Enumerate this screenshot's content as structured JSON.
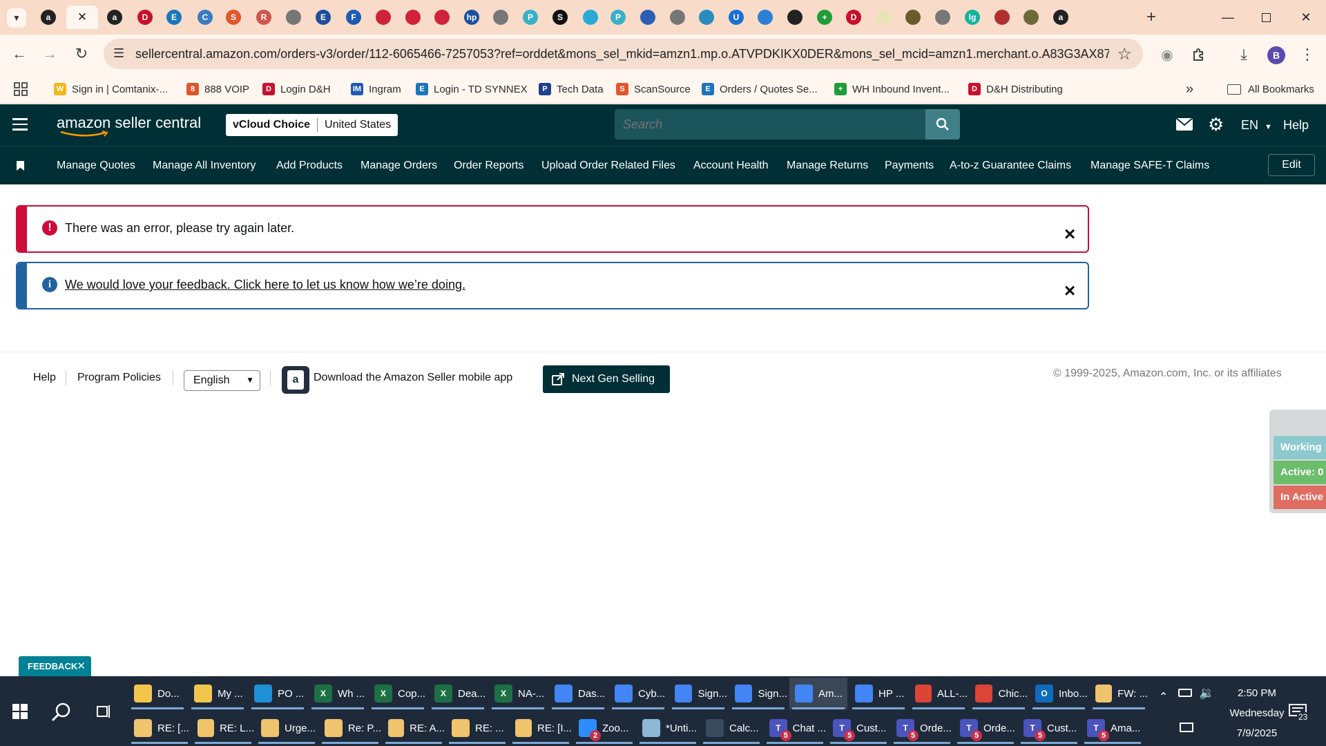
{
  "browser": {
    "tab_favicons": [
      {
        "name": "amazon-a-icon",
        "glyph": "a",
        "color": "#222222"
      },
      {
        "name": "amazon-a-icon",
        "glyph": "a",
        "color": "#222222"
      },
      {
        "name": "amazon-a-icon",
        "glyph": "a",
        "color": "#222222"
      },
      {
        "name": "dh-icon",
        "glyph": "D",
        "color": "#c8102e"
      },
      {
        "name": "ec-icon",
        "glyph": "E",
        "color": "#1b75bb"
      },
      {
        "name": "circle-icon",
        "glyph": "C",
        "color": "#3b7bbf"
      },
      {
        "name": "scansource-icon",
        "glyph": "S",
        "color": "#e2562b"
      },
      {
        "name": "circle-icon",
        "glyph": "R",
        "color": "#d0554a"
      },
      {
        "name": "globe-icon",
        "glyph": "",
        "color": "#777777"
      },
      {
        "name": "etn-icon",
        "glyph": "E",
        "color": "#1f4e9a"
      },
      {
        "name": "ingram-icon",
        "glyph": "F",
        "color": "#1e5bb5"
      },
      {
        "name": "record-icon",
        "glyph": "",
        "color": "#d0223a"
      },
      {
        "name": "record-icon",
        "glyph": "",
        "color": "#d0223a"
      },
      {
        "name": "record-icon",
        "glyph": "",
        "color": "#d0223a"
      },
      {
        "name": "hp-icon",
        "glyph": "hp",
        "color": "#1d4fa0"
      },
      {
        "name": "globe-icon",
        "glyph": "",
        "color": "#777777"
      },
      {
        "name": "link-icon",
        "glyph": "P",
        "color": "#37b0c9"
      },
      {
        "name": "s-icon",
        "glyph": "S",
        "color": "#111111"
      },
      {
        "name": "circle-icon",
        "glyph": "",
        "color": "#2aa9d6"
      },
      {
        "name": "link-icon",
        "glyph": "P",
        "color": "#37b0c9"
      },
      {
        "name": "arrow-icon",
        "glyph": "",
        "color": "#2c5fb4"
      },
      {
        "name": "globe-icon",
        "glyph": "",
        "color": "#777777"
      },
      {
        "name": "clock-icon",
        "glyph": "",
        "color": "#2a8bbf"
      },
      {
        "name": "u-icon",
        "glyph": "U",
        "color": "#1a6fd4"
      },
      {
        "name": "cloud-icon",
        "glyph": "",
        "color": "#2d7fd3"
      },
      {
        "name": "openai-icon",
        "glyph": "",
        "color": "#222222"
      },
      {
        "name": "plus-icon",
        "glyph": "+",
        "color": "#1f9d3a"
      },
      {
        "name": "dh-icon",
        "glyph": "D",
        "color": "#c8102e"
      },
      {
        "name": "chart-icon",
        "glyph": "",
        "color": "#e9e2b8"
      },
      {
        "name": "bridge-icon",
        "glyph": "",
        "color": "#6b5a2e"
      },
      {
        "name": "circle-icon",
        "glyph": "",
        "color": "#777777"
      },
      {
        "name": "logi-icon",
        "glyph": "lg",
        "color": "#14b29a"
      },
      {
        "name": "mask-icon",
        "glyph": "",
        "color": "#b03030"
      },
      {
        "name": "circle-icon",
        "glyph": "",
        "color": "#6b6b3a"
      },
      {
        "name": "amazon-a-icon",
        "glyph": "a",
        "color": "#222222"
      }
    ],
    "active_tab_index": 1,
    "url": "sellercentral.amazon.com/orders-v3/order/112-6065466-7257053?ref=orddet&mons_sel_mkid=amzn1.mp.o.ATVPDKIKX0DER&mons_sel_mcid=amzn1.merchant.o.A83G3AX87QKJF...",
    "profile_initial": "B",
    "bookmarks": [
      {
        "label": "Sign in | Comtanix-...",
        "icon": "comtanix-icon",
        "color": "#f3b71b",
        "glyph": "W"
      },
      {
        "label": "888 VOIP",
        "icon": "voip-icon",
        "color": "#e0552b",
        "glyph": "8"
      },
      {
        "label": "Login D&H",
        "icon": "dh-icon",
        "color": "#c8102e",
        "glyph": "D"
      },
      {
        "label": "Ingram",
        "icon": "ingram-icon",
        "color": "#1e5bb5",
        "glyph": "IM"
      },
      {
        "label": "Login - TD SYNNEX",
        "icon": "ec-icon",
        "color": "#1b75bb",
        "glyph": "E"
      },
      {
        "label": "Tech Data",
        "icon": "techdata-icon",
        "color": "#1f3f8f",
        "glyph": "P"
      },
      {
        "label": "ScanSource",
        "icon": "scansource-icon",
        "color": "#e2562b",
        "glyph": "S"
      },
      {
        "label": "Orders / Quotes Se...",
        "icon": "ec-icon",
        "color": "#1b75bb",
        "glyph": "E"
      },
      {
        "label": "WH Inbound Invent...",
        "icon": "plus-icon",
        "color": "#1f9d3a",
        "glyph": "+"
      },
      {
        "label": "D&H Distributing",
        "icon": "dh-icon",
        "color": "#c8102e",
        "glyph": "D"
      }
    ],
    "more_bookmarks": "»",
    "all_bookmarks": "All Bookmarks"
  },
  "seller_central": {
    "logo_text": "amazon seller central",
    "store_name": "vCloud Choice",
    "marketplace": "United States",
    "search_placeholder": "Search",
    "language": "EN",
    "help_label": "Help",
    "nav_items": [
      "Manage Quotes",
      "Manage All Inventory",
      "Add Products",
      "Manage Orders",
      "Order Reports",
      "Upload Order Related Files",
      "Account Health",
      "Manage Returns",
      "Payments",
      "A-to-z Guarantee Claims",
      "Manage SAFE-T Claims"
    ],
    "edit_label": "Edit",
    "alerts": {
      "error_text": "There was an error, please try again later.",
      "error_color": "#cc0c39",
      "info_link": "We would love your feedback. Click here to let us know how we’re doing.",
      "info_color": "#2162a1"
    },
    "footer": {
      "help": "Help",
      "program_policies": "Program Policies",
      "language_selected": "English",
      "app_download": "Download the Amazon Seller mobile app",
      "next_gen": "Next Gen Selling",
      "copyright": "© 1999-2025, Amazon.com, Inc. or its affiliates"
    },
    "side_panel": [
      {
        "label": "Working",
        "color": "#8cc9ce"
      },
      {
        "label": "Active: 0",
        "color": "#6cbd6c"
      },
      {
        "label": "In Active",
        "color": "#e06c62"
      }
    ],
    "feedback_label": "FEEDBACK"
  },
  "taskbar": {
    "row1": [
      {
        "label": "Do...",
        "icon": "folder-icon",
        "color": "#f2c64d",
        "glyph": ""
      },
      {
        "label": "My ...",
        "icon": "folder-icon",
        "color": "#f2c64d",
        "glyph": ""
      },
      {
        "label": "PO ...",
        "icon": "edge-icon",
        "color": "#1f8fd6",
        "glyph": ""
      },
      {
        "label": "Wh ...",
        "icon": "excel-icon",
        "color": "#1d7044",
        "glyph": "X"
      },
      {
        "label": "Cop...",
        "icon": "excel-icon",
        "color": "#1d7044",
        "glyph": "X"
      },
      {
        "label": "Dea...",
        "icon": "excel-icon",
        "color": "#1d7044",
        "glyph": "X"
      },
      {
        "label": "NA-...",
        "icon": "excel-icon",
        "color": "#1d7044",
        "glyph": "X"
      },
      {
        "label": "Das...",
        "icon": "chrome-icon",
        "color": "#4285f4",
        "glyph": ""
      },
      {
        "label": "Cyb...",
        "icon": "chrome-icon",
        "color": "#4285f4",
        "glyph": ""
      },
      {
        "label": "Sign...",
        "icon": "chrome-icon",
        "color": "#4285f4",
        "glyph": ""
      },
      {
        "label": "Sign...",
        "icon": "chrome-icon",
        "color": "#4285f4",
        "glyph": ""
      },
      {
        "label": "Am...",
        "icon": "chrome-icon",
        "color": "#4285f4",
        "glyph": ""
      },
      {
        "label": "HP ...",
        "icon": "chrome-icon",
        "color": "#4285f4",
        "glyph": ""
      },
      {
        "label": "ALL-...",
        "icon": "chrome-icon",
        "color": "#db4437",
        "glyph": ""
      },
      {
        "label": "Chic...",
        "icon": "chrome-icon",
        "color": "#db4437",
        "glyph": ""
      },
      {
        "label": "Inbo...",
        "icon": "outlook-icon",
        "color": "#0f6cbd",
        "glyph": "O"
      },
      {
        "label": "FW: ...",
        "icon": "mail-icon",
        "color": "#f0c36d",
        "glyph": ""
      }
    ],
    "row2": [
      {
        "label": "RE: [...",
        "icon": "mail-icon",
        "color": "#f0c36d",
        "glyph": "",
        "badge": ""
      },
      {
        "label": "RE: L...",
        "icon": "mail-icon",
        "color": "#f0c36d",
        "glyph": "",
        "badge": ""
      },
      {
        "label": "Urge...",
        "icon": "mail-icon",
        "color": "#f0c36d",
        "glyph": "",
        "badge": ""
      },
      {
        "label": "Re: P...",
        "icon": "mail-icon",
        "color": "#f0c36d",
        "glyph": "",
        "badge": ""
      },
      {
        "label": "RE: A...",
        "icon": "mail-icon",
        "color": "#f0c36d",
        "glyph": "",
        "badge": ""
      },
      {
        "label": "RE: ...",
        "icon": "mail-icon",
        "color": "#f0c36d",
        "glyph": "",
        "badge": ""
      },
      {
        "label": "RE: [I...",
        "icon": "mail-icon",
        "color": "#f0c36d",
        "glyph": "",
        "badge": ""
      },
      {
        "label": "Zoo...",
        "icon": "zoom-icon",
        "color": "#2d8cff",
        "glyph": "",
        "badge": "2"
      },
      {
        "label": "*Unti...",
        "icon": "notepad-icon",
        "color": "#8fb8d8",
        "glyph": "",
        "badge": ""
      },
      {
        "label": "Calc...",
        "icon": "calculator-icon",
        "color": "#3a4a5c",
        "glyph": "",
        "badge": ""
      },
      {
        "label": "Chat ...",
        "icon": "teams-icon",
        "color": "#4b53bc",
        "glyph": "T",
        "badge": "5"
      },
      {
        "label": "Cust...",
        "icon": "teams-icon",
        "color": "#4b53bc",
        "glyph": "T",
        "badge": "5"
      },
      {
        "label": "Orde...",
        "icon": "teams-icon",
        "color": "#4b53bc",
        "glyph": "T",
        "badge": "5"
      },
      {
        "label": "Orde...",
        "icon": "teams-icon",
        "color": "#4b53bc",
        "glyph": "T",
        "badge": "5"
      },
      {
        "label": "Cust...",
        "icon": "teams-icon",
        "color": "#4b53bc",
        "glyph": "T",
        "badge": "5"
      },
      {
        "label": "Ama...",
        "icon": "teams-icon",
        "color": "#4b53bc",
        "glyph": "T",
        "badge": "5"
      }
    ],
    "time": "2:50 PM",
    "day": "Wednesday",
    "date": "7/9/2025",
    "notification_count": "23"
  }
}
